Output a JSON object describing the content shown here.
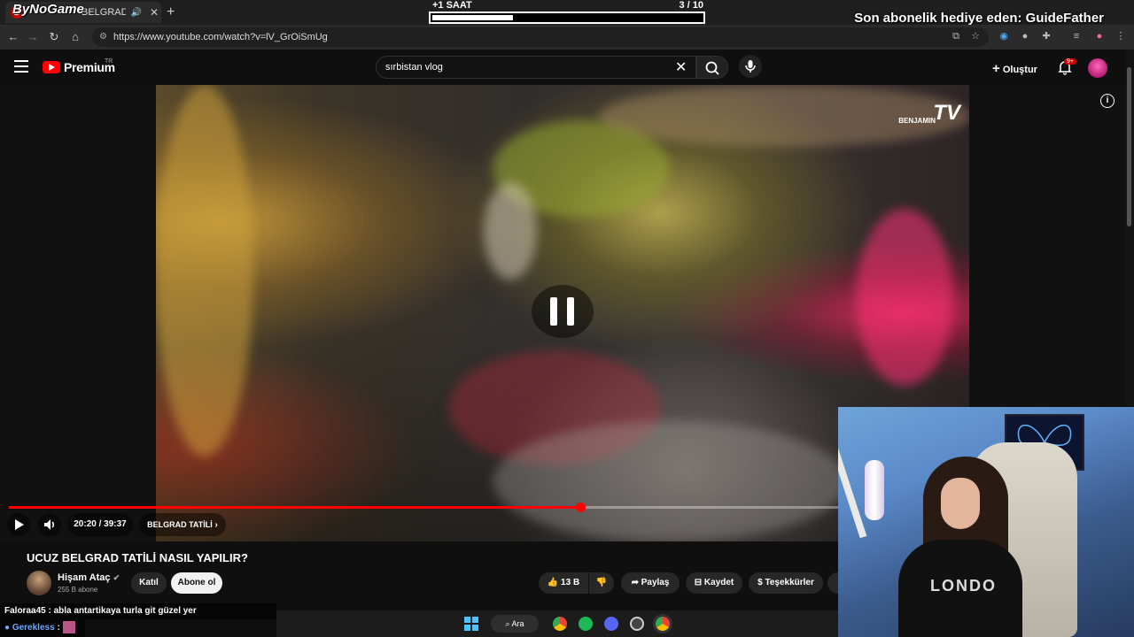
{
  "browser": {
    "tab_title": "BELGRAD TATİLİ",
    "tab_favicon": "B",
    "url": "https://www.youtube.com/watch?v=lV_GrOiSmUg",
    "new_tab": "+"
  },
  "stream_overlay": {
    "logo_text": "ByNoGame",
    "goal_label": "+1 SAAT",
    "goal_progress_text": "3  / 10",
    "goal_progress": 0.3,
    "sub_alert": "Son abonelik hediye eden: GuideFather"
  },
  "youtube": {
    "logo_text": "Premium",
    "country": "TR",
    "search_value": "sırbistan vlog",
    "create_label": "Oluştur",
    "notif_count": "9+"
  },
  "player": {
    "watermark": "TV",
    "watermark_small": "BENJAMIN",
    "time": "20:20 / 39:37",
    "chapter": "BELGRAD TATİLİ",
    "played_fraction": 0.514,
    "info": "i"
  },
  "video_info": {
    "title": "UCUZ BELGRAD TATİLİ NASIL YAPILIR?",
    "channel": "Hişam Ataç",
    "subs": "255 B abone",
    "join": "Katıl",
    "subscribe": "Abone ol",
    "likes": "13 B",
    "share": "Paylaş",
    "save": "Kaydet",
    "thanks": "Teşekkürler"
  },
  "chat": {
    "msg1_user": "Faloraa45",
    "msg1_text": ": abla antartikaya turla git güzel yer",
    "msg2_user": "Gerekless",
    "msg2_sep": ":"
  },
  "taskbar": {
    "search_label": "Ara"
  },
  "webcam": {
    "shirt_text": "LONDO"
  },
  "colors": {
    "accent": "#ff0000",
    "chat_user1": "#ffffff",
    "chat_user2": "#6fa8ff"
  }
}
